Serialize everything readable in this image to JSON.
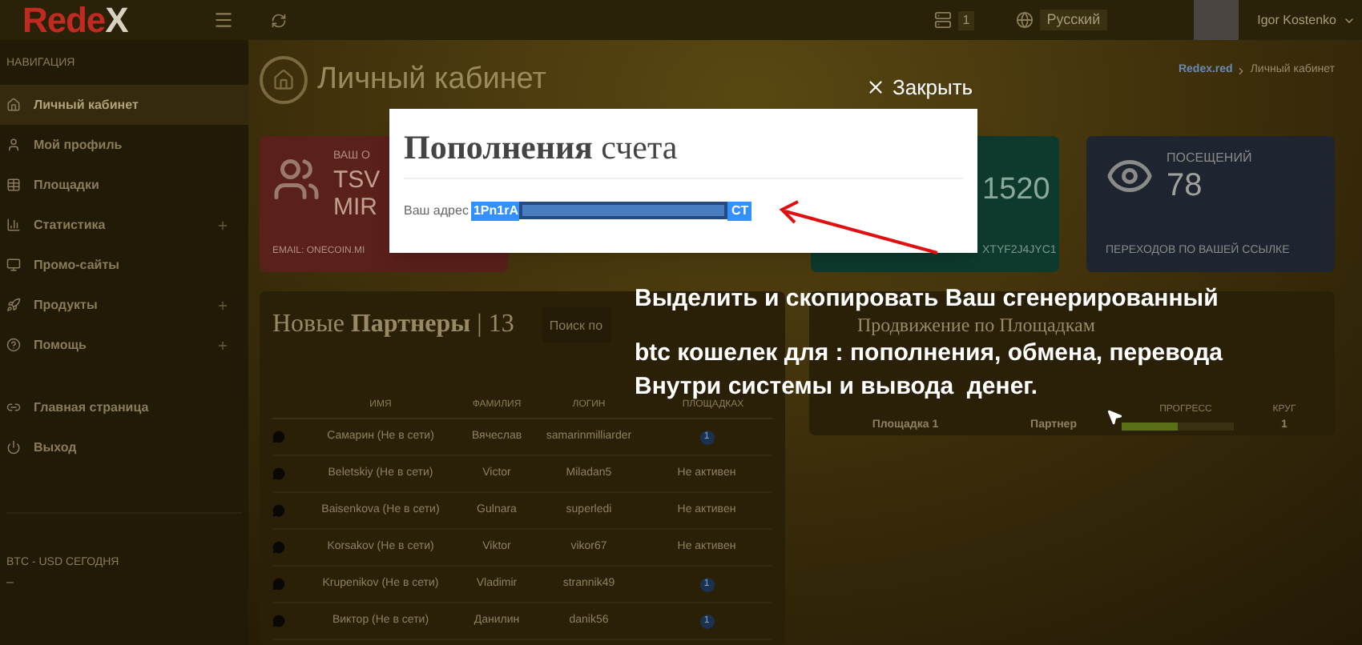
{
  "header": {
    "logo_main": "Rede",
    "logo_accent": "X",
    "messages_badge": "1",
    "language": "Русский",
    "user_name": "Igor Kostenko"
  },
  "sidebar": {
    "heading": "НАВИГАЦИЯ",
    "items": [
      {
        "label": "Личный кабинет",
        "selected": true,
        "expandable": false
      },
      {
        "label": "Мой профиль",
        "selected": false,
        "expandable": false
      },
      {
        "label": "Площадки",
        "selected": false,
        "expandable": false
      },
      {
        "label": "Статистика",
        "selected": false,
        "expandable": true
      },
      {
        "label": "Промо-сайты",
        "selected": false,
        "expandable": false
      },
      {
        "label": "Продукты",
        "selected": false,
        "expandable": true
      },
      {
        "label": "Помощь",
        "selected": false,
        "expandable": true
      }
    ],
    "links": [
      {
        "label": "Главная страница"
      },
      {
        "label": "Выход"
      }
    ],
    "rate_title": "BTC - USD СЕГОДНЯ",
    "rate_value": "–"
  },
  "page": {
    "title": "Личный кабинет",
    "breadcrumb": [
      "Redex.red",
      "Личный кабинет"
    ]
  },
  "cards": [
    {
      "kind": "sponsor",
      "caption": "ВАШ О",
      "name_line1": "TSV",
      "name_line2": "MIR",
      "footer": "EMAIL: ONECOIN.MI"
    },
    {
      "kind": "hidden"
    },
    {
      "kind": "wallet",
      "value": "1520",
      "footer": "XTYF2J4JYC1"
    },
    {
      "kind": "visits",
      "caption": "ПОСЕЩЕНИЙ",
      "value": "78",
      "footer": "ПЕРЕХОДОВ ПО ВАШЕЙ ССЫЛКЕ"
    }
  ],
  "partners": {
    "title": "Новые **Партнеры** | 13",
    "search_placeholder": "Поиск по",
    "columns": [
      "ИМЯ",
      "ФАМИЛИЯ",
      "ЛОГИН",
      "ПЛОЩАДКАХ"
    ],
    "rows": [
      {
        "name": "Самарин (Не в сети)",
        "surname": "Вячеслав",
        "login": "samarinmilliarder",
        "status": {
          "kind": "count",
          "text": "1"
        }
      },
      {
        "name": "Beletskiy (Не в сети)",
        "surname": "Victor",
        "login": "Miladan5",
        "status": {
          "kind": "text",
          "text": "Не активен"
        }
      },
      {
        "name": "Baisenkova (Не в сети)",
        "surname": "Gulnara",
        "login": "superledi",
        "status": {
          "kind": "text",
          "text": "Не активен"
        }
      },
      {
        "name": "Korsakov (Не в сети)",
        "surname": "Viktor",
        "login": "vikor67",
        "status": {
          "kind": "text",
          "text": "Не активен"
        }
      },
      {
        "name": "Krupenikov (Не в сети)",
        "surname": "Vladimir",
        "login": "strannik49",
        "status": {
          "kind": "count",
          "text": "1"
        }
      },
      {
        "name": "Виктор (Не в сети)",
        "surname": "Данилин",
        "login": "danik56",
        "status": {
          "kind": "count",
          "text": "1"
        }
      }
    ]
  },
  "promotion": {
    "title": "Продвижение по Площадкам",
    "column_3": "ПРОГРЕСС",
    "column_4": "КРУГ",
    "rows": [
      {
        "site": "Площадка 1",
        "status": "Партнер",
        "level": 0.5,
        "round": "1"
      }
    ]
  },
  "modal": {
    "close": "Закрыть",
    "title": "**Пополнения** счета",
    "address_label": "Ваш адрес",
    "address_start": "1Pn1rA",
    "address_end": "CT"
  },
  "annotation": {
    "lines": [
      "Выделить и скопировать Ваш сгенерированный",
      "btc кошелек для : пополнения, обмена, перевода",
      "Внутри системы и вывода  денег."
    ]
  }
}
